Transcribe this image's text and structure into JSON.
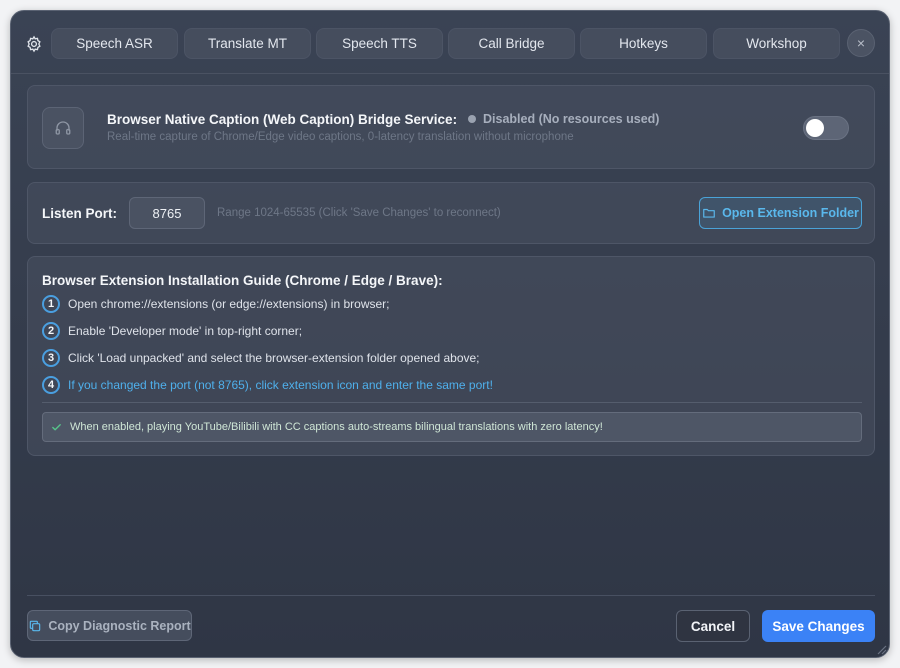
{
  "tabs": [
    {
      "label": "Speech ASR"
    },
    {
      "label": "Translate MT"
    },
    {
      "label": "Speech TTS"
    },
    {
      "label": "Call Bridge"
    },
    {
      "label": "Hotkeys"
    },
    {
      "label": "Workshop"
    }
  ],
  "close_label": "×",
  "service": {
    "icon": "headphones-icon",
    "title": "Browser Native Caption (Web Caption) Bridge Service:",
    "status": "Disabled (No resources used)",
    "subtitle": "Real-time capture of Chrome/Edge video captions, 0-latency translation without microphone",
    "enabled": false
  },
  "port": {
    "label": "Listen Port:",
    "value": "8765",
    "hint": "Range 1024-65535 (Click 'Save Changes' to reconnect)",
    "open_folder_label": "Open Extension Folder"
  },
  "guide": {
    "title": "Browser Extension Installation Guide (Chrome / Edge / Brave):",
    "steps": [
      {
        "num": "1",
        "text": "Open chrome://extensions (or edge://extensions) in browser;"
      },
      {
        "num": "2",
        "text": "Enable 'Developer mode' in top-right corner;"
      },
      {
        "num": "3",
        "text": "Click 'Load unpacked' and select the browser-extension folder opened above;"
      },
      {
        "num": "4",
        "text": "If you changed the port (not 8765), click extension icon and enter the same port!"
      }
    ],
    "tip": "When enabled, playing YouTube/Bilibili with CC captions auto-streams bilingual translations with zero latency!"
  },
  "footer": {
    "copy_diag_label": "Copy Diagnostic Report",
    "cancel_label": "Cancel",
    "save_label": "Save Changes"
  },
  "colors": {
    "accent": "#3b82f6",
    "link": "#4fb0ec",
    "success": "#56c58a"
  }
}
